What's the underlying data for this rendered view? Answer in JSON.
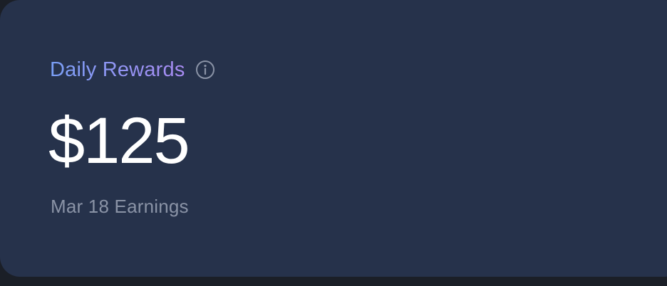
{
  "card": {
    "title": "Daily Rewards",
    "amount": "$125",
    "subtitle": "Mar 18 Earnings",
    "info_icon": "info-circle-icon"
  },
  "colors": {
    "card_background": "#26324b",
    "page_background": "#1b1f27",
    "title_gradient_start": "#7aa0f7",
    "title_gradient_end": "#a98bf2",
    "amount_text": "#ffffff",
    "subtitle_text": "#8a93a6",
    "icon_stroke": "#8a93a6"
  }
}
